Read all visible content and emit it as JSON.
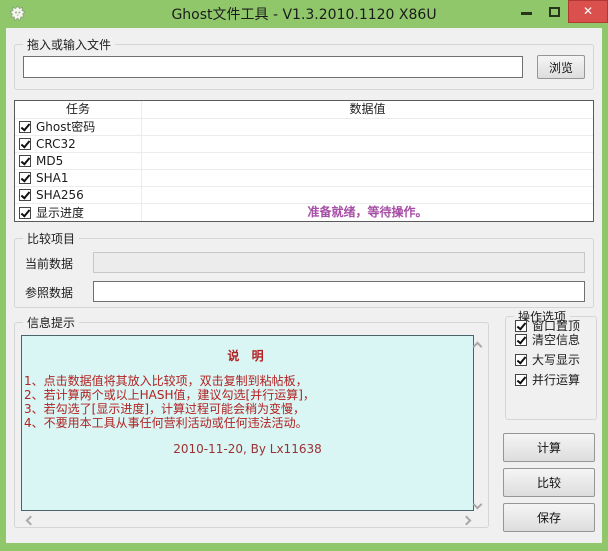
{
  "window": {
    "title": "Ghost文件工具 - V1.3.2010.1120 X86U",
    "close_glyph": "✕"
  },
  "colors": {
    "titlebar_green": "#90c76b",
    "close_red": "#d9504c",
    "client_bg": "#f0f0f0",
    "info_bg": "#d9f5f4",
    "info_text_red": "#b22222",
    "status_magenta": "#a64fa6"
  },
  "file_group": {
    "label": "拖入或输入文件",
    "input_value": "",
    "browse_button": "浏览"
  },
  "task_table": {
    "col_task": "任务",
    "col_value": "数据值",
    "rows": [
      {
        "label": "Ghost密码",
        "checked": true,
        "value": ""
      },
      {
        "label": "CRC32",
        "checked": true,
        "value": ""
      },
      {
        "label": "MD5",
        "checked": true,
        "value": ""
      },
      {
        "label": "SHA1",
        "checked": true,
        "value": ""
      },
      {
        "label": "SHA256",
        "checked": true,
        "value": ""
      },
      {
        "label": "显示进度",
        "checked": true,
        "value": "准备就绪，等待操作。"
      }
    ]
  },
  "compare_group": {
    "label": "比较项目",
    "current_label": "当前数据",
    "current_value": "",
    "reference_label": "参照数据",
    "reference_value": ""
  },
  "info_group": {
    "label": "信息提示",
    "heading": "说 明",
    "lines": [
      "1、点击数据值将其放入比较项，双击复制到粘帖板，",
      "2、若计算两个或以上HASH值，建议勾选[并行运算]，",
      "3、若勾选了[显示进度]，计算过程可能会稍为变慢，",
      "4、不要用本工具从事任何营利活动或任何违法活动。"
    ],
    "footer": "2010-11-20, By Lx11638"
  },
  "options_group": {
    "label": "操作选项",
    "options": [
      {
        "label": "窗口置顶",
        "checked": true
      },
      {
        "label": "清空信息",
        "checked": true
      },
      {
        "label": "大写显示",
        "checked": true
      },
      {
        "label": "并行运算",
        "checked": true
      }
    ]
  },
  "buttons": {
    "calculate": "计算",
    "compare": "比较",
    "save": "保存"
  }
}
